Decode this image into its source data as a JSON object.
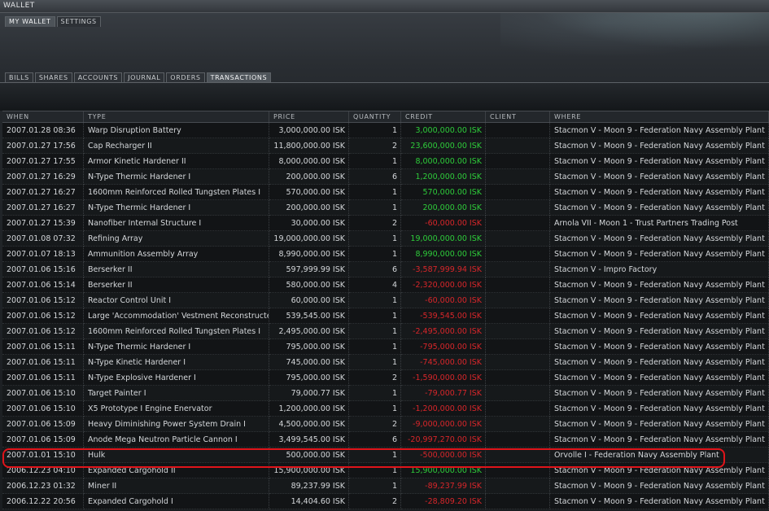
{
  "window": {
    "title": "WALLET"
  },
  "top_tabs": [
    {
      "label": "MY WALLET",
      "active": true
    },
    {
      "label": "SETTINGS",
      "active": false
    }
  ],
  "sub_tabs": [
    {
      "label": "BILLS",
      "active": false
    },
    {
      "label": "SHARES",
      "active": false
    },
    {
      "label": "ACCOUNTS",
      "active": false
    },
    {
      "label": "JOURNAL",
      "active": false
    },
    {
      "label": "ORDERS",
      "active": false
    },
    {
      "label": "TRANSACTIONS",
      "active": true
    }
  ],
  "table": {
    "columns": [
      "WHEN",
      "TYPE",
      "PRICE",
      "QUANTITY",
      "CREDIT",
      "CLIENT",
      "WHERE"
    ],
    "rows": [
      {
        "when": "2007.01.28 08:36",
        "type": "Warp Disruption Battery",
        "price": "3,000,000.00 ISK",
        "quantity": "1",
        "credit": "3,000,000.00 ISK",
        "credit_sign": "pos",
        "client": "",
        "where": "Stacmon V - Moon 9 - Federation Navy Assembly Plant"
      },
      {
        "when": "2007.01.27 17:56",
        "type": "Cap Recharger II",
        "price": "11,800,000.00 ISK",
        "quantity": "2",
        "credit": "23,600,000.00 ISK",
        "credit_sign": "pos",
        "client": "",
        "where": "Stacmon V - Moon 9 - Federation Navy Assembly Plant"
      },
      {
        "when": "2007.01.27 17:55",
        "type": "Armor Kinetic Hardener II",
        "price": "8,000,000.00 ISK",
        "quantity": "1",
        "credit": "8,000,000.00 ISK",
        "credit_sign": "pos",
        "client": "",
        "where": "Stacmon V - Moon 9 - Federation Navy Assembly Plant"
      },
      {
        "when": "2007.01.27 16:29",
        "type": "N-Type Thermic Hardener I",
        "price": "200,000.00 ISK",
        "quantity": "6",
        "credit": "1,200,000.00 ISK",
        "credit_sign": "pos",
        "client": "",
        "where": "Stacmon V - Moon 9 - Federation Navy Assembly Plant"
      },
      {
        "when": "2007.01.27 16:27",
        "type": "1600mm Reinforced Rolled Tungsten Plates I",
        "price": "570,000.00 ISK",
        "quantity": "1",
        "credit": "570,000.00 ISK",
        "credit_sign": "pos",
        "client": "",
        "where": "Stacmon V - Moon 9 - Federation Navy Assembly Plant"
      },
      {
        "when": "2007.01.27 16:27",
        "type": "N-Type Thermic Hardener I",
        "price": "200,000.00 ISK",
        "quantity": "1",
        "credit": "200,000.00 ISK",
        "credit_sign": "pos",
        "client": "",
        "where": "Stacmon V - Moon 9 - Federation Navy Assembly Plant"
      },
      {
        "when": "2007.01.27 15:39",
        "type": "Nanofiber Internal Structure I",
        "price": "30,000.00 ISK",
        "quantity": "2",
        "credit": "-60,000.00 ISK",
        "credit_sign": "neg",
        "client": "",
        "where": "Arnola VII - Moon 1 - Trust Partners Trading Post"
      },
      {
        "when": "2007.01.08 07:32",
        "type": "Refining Array",
        "price": "19,000,000.00 ISK",
        "quantity": "1",
        "credit": "19,000,000.00 ISK",
        "credit_sign": "pos",
        "client": "",
        "where": "Stacmon V - Moon 9 - Federation Navy Assembly Plant"
      },
      {
        "when": "2007.01.07 18:13",
        "type": "Ammunition Assembly Array",
        "price": "8,990,000.00 ISK",
        "quantity": "1",
        "credit": "8,990,000.00 ISK",
        "credit_sign": "pos",
        "client": "",
        "where": "Stacmon V - Moon 9 - Federation Navy Assembly Plant"
      },
      {
        "when": "2007.01.06 15:16",
        "type": "Berserker II",
        "price": "597,999.99 ISK",
        "quantity": "6",
        "credit": "-3,587,999.94 ISK",
        "credit_sign": "neg",
        "client": "",
        "where": "Stacmon V - Impro Factory"
      },
      {
        "when": "2007.01.06 15:14",
        "type": "Berserker II",
        "price": "580,000.00 ISK",
        "quantity": "4",
        "credit": "-2,320,000.00 ISK",
        "credit_sign": "neg",
        "client": "",
        "where": "Stacmon V - Moon 9 - Federation Navy Assembly Plant"
      },
      {
        "when": "2007.01.06 15:12",
        "type": "Reactor Control Unit I",
        "price": "60,000.00 ISK",
        "quantity": "1",
        "credit": "-60,000.00 ISK",
        "credit_sign": "neg",
        "client": "",
        "where": "Stacmon V - Moon 9 - Federation Navy Assembly Plant"
      },
      {
        "when": "2007.01.06 15:12",
        "type": "Large 'Accommodation' Vestment Reconstructer I",
        "price": "539,545.00 ISK",
        "quantity": "1",
        "credit": "-539,545.00 ISK",
        "credit_sign": "neg",
        "client": "",
        "where": "Stacmon V - Moon 9 - Federation Navy Assembly Plant"
      },
      {
        "when": "2007.01.06 15:12",
        "type": "1600mm Reinforced Rolled Tungsten Plates I",
        "price": "2,495,000.00 ISK",
        "quantity": "1",
        "credit": "-2,495,000.00 ISK",
        "credit_sign": "neg",
        "client": "",
        "where": "Stacmon V - Moon 9 - Federation Navy Assembly Plant"
      },
      {
        "when": "2007.01.06 15:11",
        "type": "N-Type Thermic Hardener I",
        "price": "795,000.00 ISK",
        "quantity": "1",
        "credit": "-795,000.00 ISK",
        "credit_sign": "neg",
        "client": "",
        "where": "Stacmon V - Moon 9 - Federation Navy Assembly Plant"
      },
      {
        "when": "2007.01.06 15:11",
        "type": "N-Type Kinetic Hardener I",
        "price": "745,000.00 ISK",
        "quantity": "1",
        "credit": "-745,000.00 ISK",
        "credit_sign": "neg",
        "client": "",
        "where": "Stacmon V - Moon 9 - Federation Navy Assembly Plant"
      },
      {
        "when": "2007.01.06 15:11",
        "type": "N-Type Explosive Hardener I",
        "price": "795,000.00 ISK",
        "quantity": "2",
        "credit": "-1,590,000.00 ISK",
        "credit_sign": "neg",
        "client": "",
        "where": "Stacmon V - Moon 9 - Federation Navy Assembly Plant"
      },
      {
        "when": "2007.01.06 15:10",
        "type": "Target Painter I",
        "price": "79,000.77 ISK",
        "quantity": "1",
        "credit": "-79,000.77 ISK",
        "credit_sign": "neg",
        "client": "",
        "where": "Stacmon V - Moon 9 - Federation Navy Assembly Plant"
      },
      {
        "when": "2007.01.06 15:10",
        "type": "X5 Prototype I Engine Enervator",
        "price": "1,200,000.00 ISK",
        "quantity": "1",
        "credit": "-1,200,000.00 ISK",
        "credit_sign": "neg",
        "client": "",
        "where": "Stacmon V - Moon 9 - Federation Navy Assembly Plant"
      },
      {
        "when": "2007.01.06 15:09",
        "type": "Heavy Diminishing Power System Drain I",
        "price": "4,500,000.00 ISK",
        "quantity": "2",
        "credit": "-9,000,000.00 ISK",
        "credit_sign": "neg",
        "client": "",
        "where": "Stacmon V - Moon 9 - Federation Navy Assembly Plant"
      },
      {
        "when": "2007.01.06 15:09",
        "type": "Anode Mega Neutron Particle Cannon I",
        "price": "3,499,545.00 ISK",
        "quantity": "6",
        "credit": "-20,997,270.00 ISK",
        "credit_sign": "neg",
        "client": "",
        "where": "Stacmon V - Moon 9 - Federation Navy Assembly Plant"
      },
      {
        "when": "2007.01.01 15:10",
        "type": "Hulk",
        "price": "500,000.00 ISK",
        "quantity": "1",
        "credit": "-500,000.00 ISK",
        "credit_sign": "neg",
        "client": "",
        "where": "Orvolle I - Federation Navy Assembly Plant"
      },
      {
        "when": "2006.12.23 04:10",
        "type": "Expanded Cargohold II",
        "price": "15,900,000.00 ISK",
        "quantity": "1",
        "credit": "15,900,000.00 ISK",
        "credit_sign": "pos",
        "client": "",
        "where": "Stacmon V - Moon 9 - Federation Navy Assembly Plant"
      },
      {
        "when": "2006.12.23 01:32",
        "type": "Miner II",
        "price": "89,237.99 ISK",
        "quantity": "1",
        "credit": "-89,237.99 ISK",
        "credit_sign": "neg",
        "client": "",
        "where": "Stacmon V - Moon 9 - Federation Navy Assembly Plant"
      },
      {
        "when": "2006.12.22 20:56",
        "type": "Expanded Cargohold I",
        "price": "14,404.60 ISK",
        "quantity": "2",
        "credit": "-28,809.20 ISK",
        "credit_sign": "neg",
        "client": "",
        "where": "Stacmon V - Moon 9 - Federation Navy Assembly Plant"
      }
    ]
  },
  "colors": {
    "credit_positive": "#2ecc3a",
    "credit_negative": "#d8262a",
    "highlight": "#e0141a"
  }
}
